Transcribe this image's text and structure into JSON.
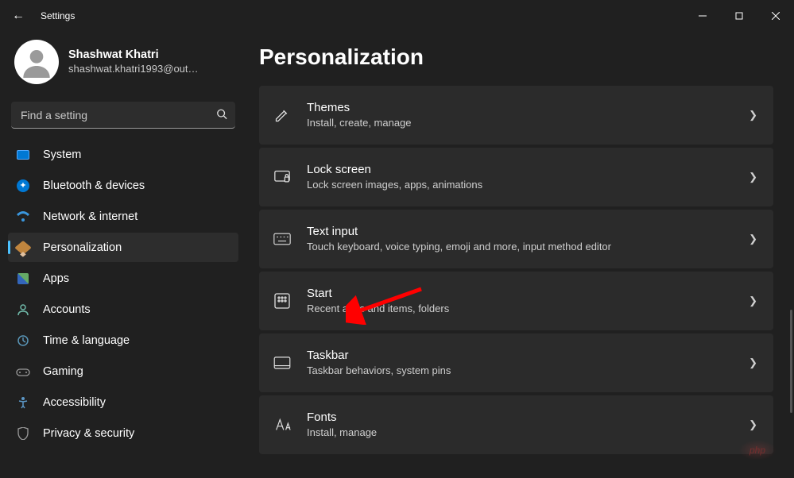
{
  "window": {
    "title": "Settings"
  },
  "profile": {
    "name": "Shashwat Khatri",
    "email": "shashwat.khatri1993@out…"
  },
  "search": {
    "placeholder": "Find a setting"
  },
  "nav": {
    "items": [
      {
        "label": "System"
      },
      {
        "label": "Bluetooth & devices"
      },
      {
        "label": "Network & internet"
      },
      {
        "label": "Personalization",
        "active": true
      },
      {
        "label": "Apps"
      },
      {
        "label": "Accounts"
      },
      {
        "label": "Time & language"
      },
      {
        "label": "Gaming"
      },
      {
        "label": "Accessibility"
      },
      {
        "label": "Privacy & security"
      }
    ]
  },
  "page": {
    "title": "Personalization"
  },
  "cards": [
    {
      "title": "Themes",
      "desc": "Install, create, manage"
    },
    {
      "title": "Lock screen",
      "desc": "Lock screen images, apps, animations"
    },
    {
      "title": "Text input",
      "desc": "Touch keyboard, voice typing, emoji and more, input method editor"
    },
    {
      "title": "Start",
      "desc": "Recent apps and items, folders"
    },
    {
      "title": "Taskbar",
      "desc": "Taskbar behaviors, system pins"
    },
    {
      "title": "Fonts",
      "desc": "Install, manage"
    }
  ],
  "watermark": "php"
}
